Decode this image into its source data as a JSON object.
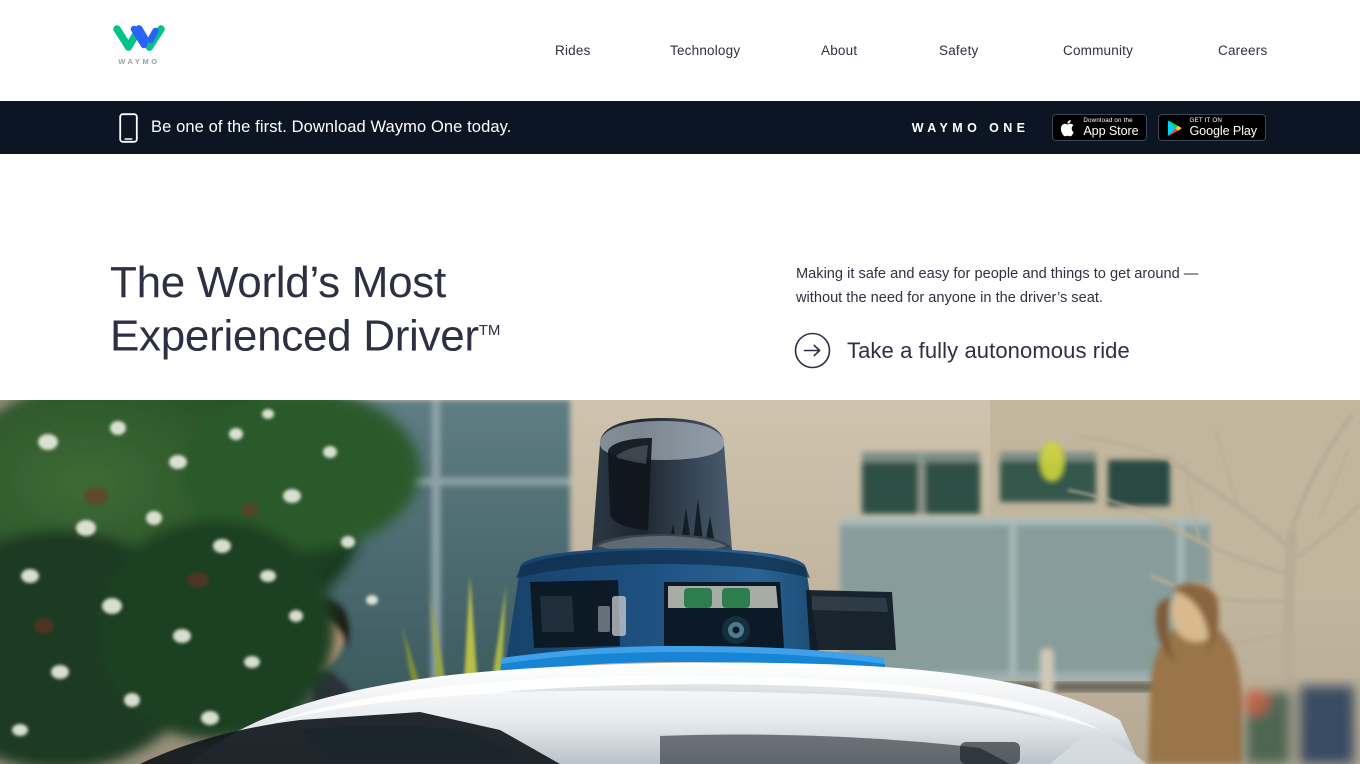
{
  "brand": {
    "logo_icon": "waymo-w-logo",
    "wordmark": "WAYMO",
    "logo_green": "#00c389",
    "logo_blue": "#2a63f6"
  },
  "nav": {
    "items": [
      {
        "label": "Rides"
      },
      {
        "label": "Technology"
      },
      {
        "label": "About"
      },
      {
        "label": "Safety"
      },
      {
        "label": "Community"
      },
      {
        "label": "Careers"
      }
    ]
  },
  "banner": {
    "background": "#0b1523",
    "phone_icon": "smartphone-icon",
    "message": "Be one of the first. Download Waymo One today.",
    "product_wordmark": "WAYMO ONE",
    "app_store": {
      "icon": "apple-logo-icon",
      "small_label": "Download on the",
      "big_label": "App Store"
    },
    "google_play": {
      "icon": "google-play-triangle-icon",
      "small_label": "GET IT ON",
      "big_label": "Google Play"
    }
  },
  "hero": {
    "headline_line1": "The World’s Most",
    "headline_line2": "Experienced Driver",
    "headline_trademark": "TM",
    "subtitle": "Making it safe and easy for people and things to get around — without the need for anyone in the driver’s seat.",
    "cta_icon": "arrow-right-circle-icon",
    "cta_label": "Take a fully autonomous ride",
    "text_color": "#2d2f42",
    "image_alt": "waymo-self-driving-car-with-lidar-sensor-street-scene"
  }
}
